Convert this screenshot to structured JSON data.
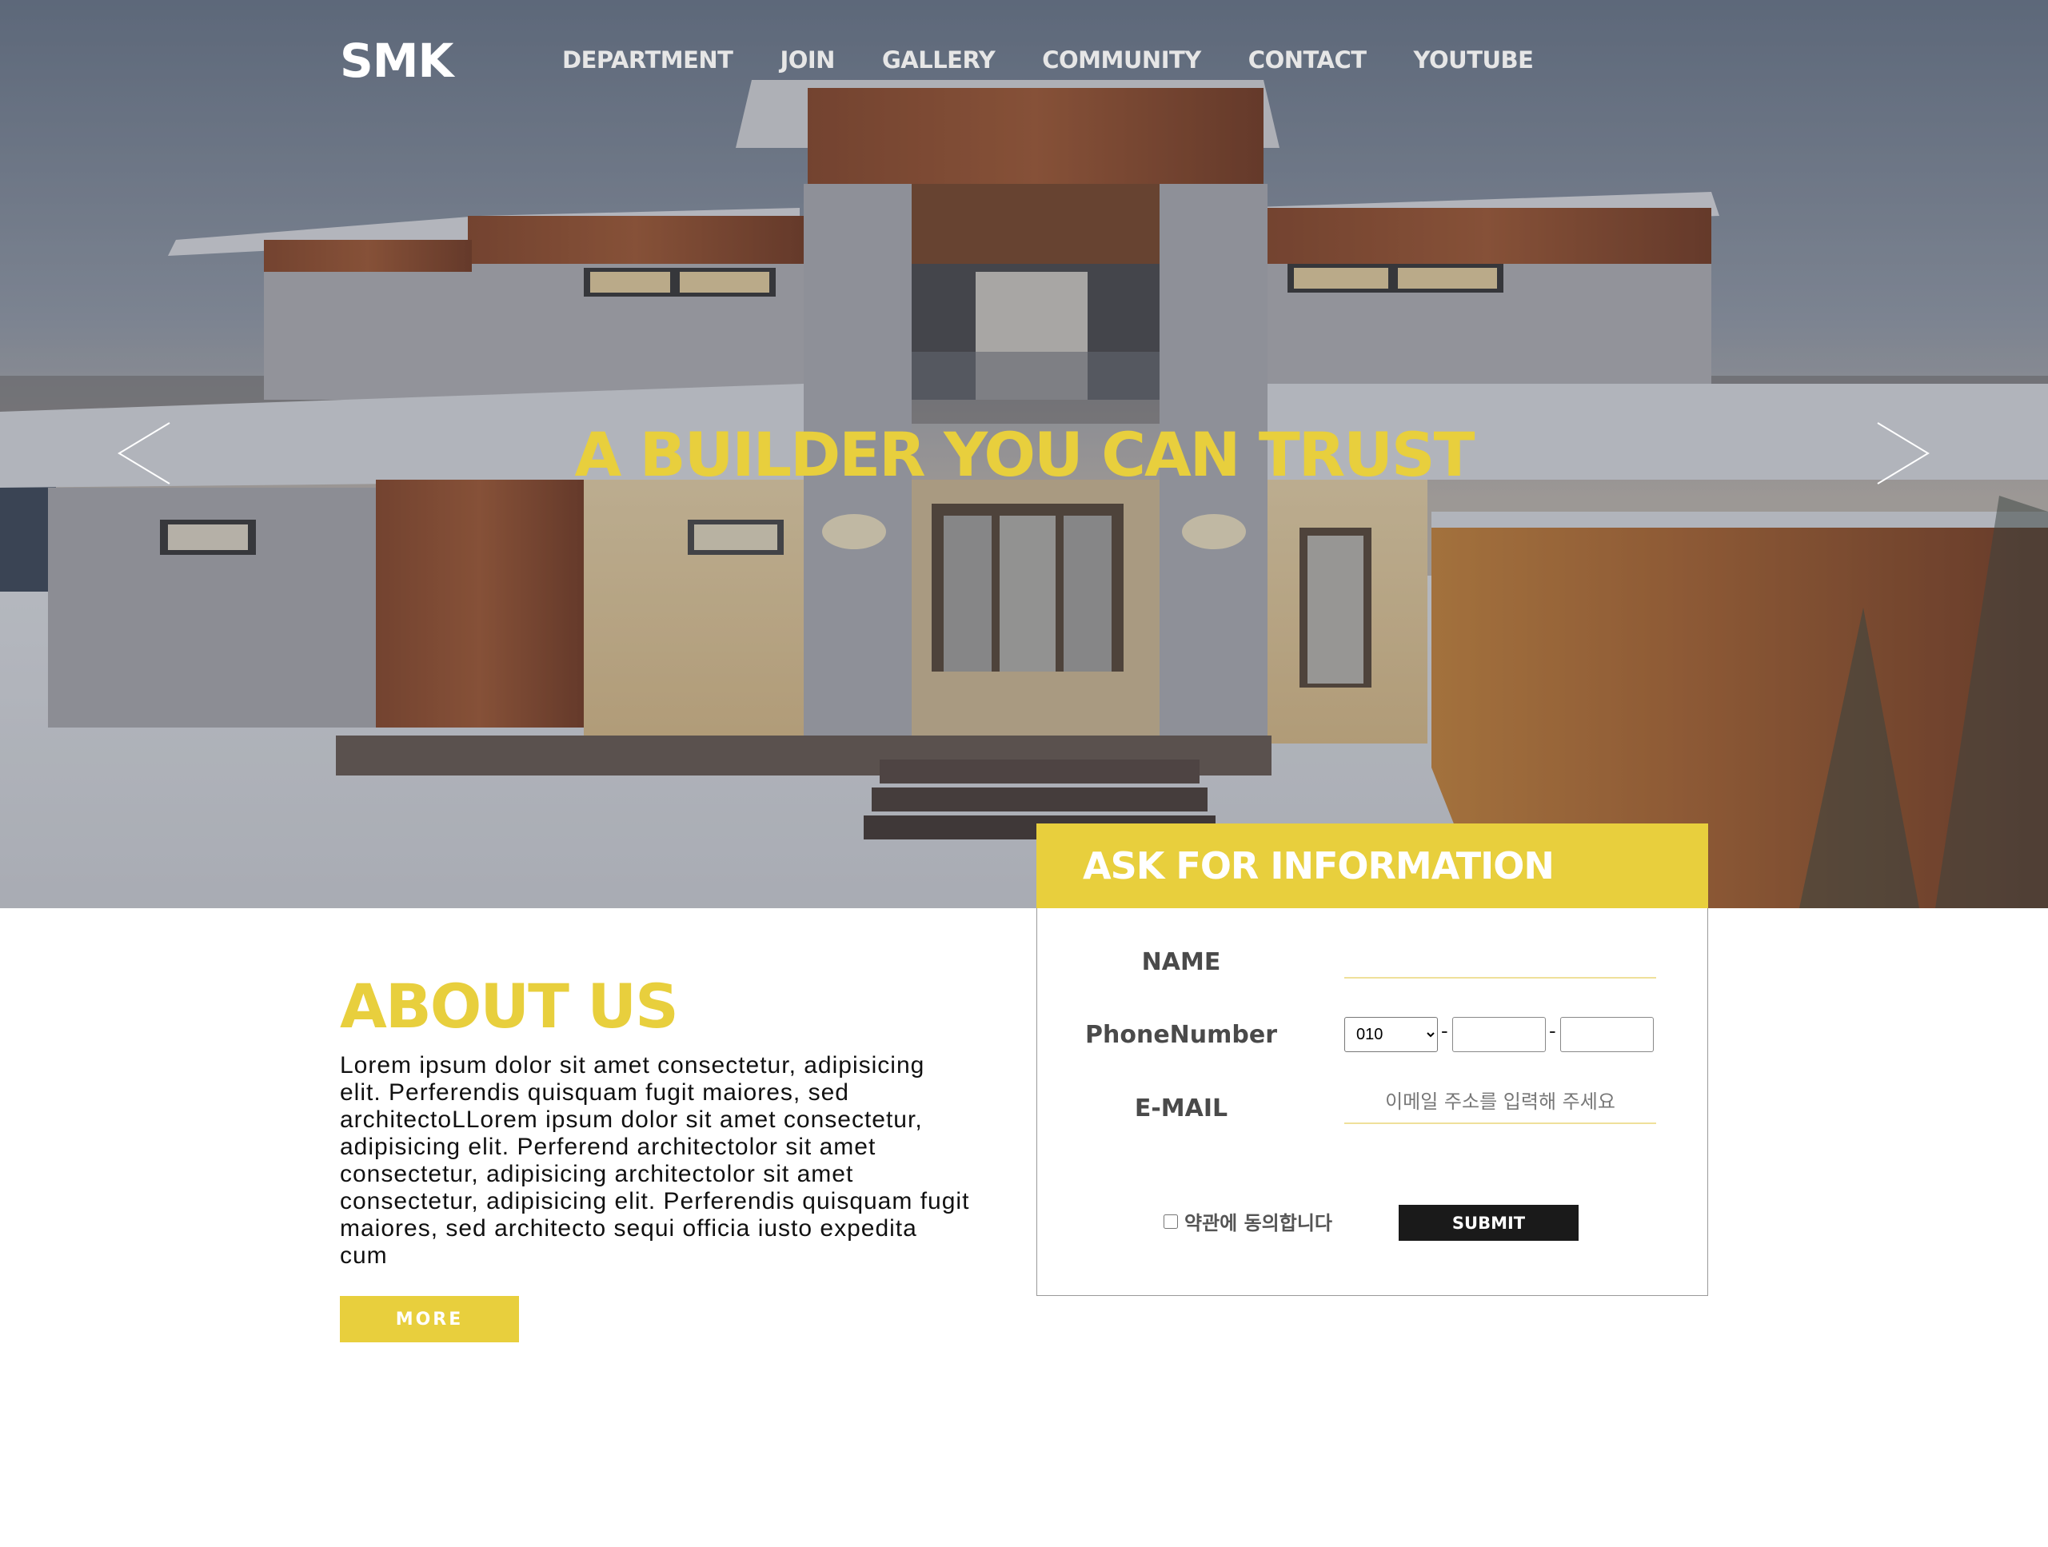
{
  "header": {
    "logo": "SMK",
    "nav": [
      "DEPARTMENT",
      "JOIN",
      "GALLERY",
      "COMMUNITY",
      "CONTACT",
      "YOUTUBE"
    ]
  },
  "hero": {
    "headline": "A BUILDER YOU CAN TRUST",
    "prev_icon": "chevron-left-icon",
    "next_icon": "chevron-right-icon"
  },
  "about": {
    "title": "ABOUT US",
    "text": "Lorem ipsum dolor sit amet consectetur, adipisicing elit. Perferendis quisquam fugit maiores, sed architectoLLorem ipsum dolor sit amet consectetur, adipisicing elit. Perferend architectolor sit amet consectetur, adipisicing architectolor sit amet consectetur, adipisicing elit. Perferendis quisquam fugit maiores, sed architecto sequi officia iusto expedita cum",
    "more_label": "MORE"
  },
  "form": {
    "title": "ASK FOR INFORMATION",
    "name_label": "NAME",
    "phone_label": "PhoneNumber",
    "phone_prefix": "010",
    "phone_separator": "-",
    "email_label": "E-MAIL",
    "email_placeholder": "이메일 주소를 입력해 주세요",
    "agree_label": "약관에 동의합니다",
    "submit_label": "SUBMIT"
  },
  "colors": {
    "accent": "#e8cf3d",
    "submit_bg": "#1a1a1a"
  }
}
